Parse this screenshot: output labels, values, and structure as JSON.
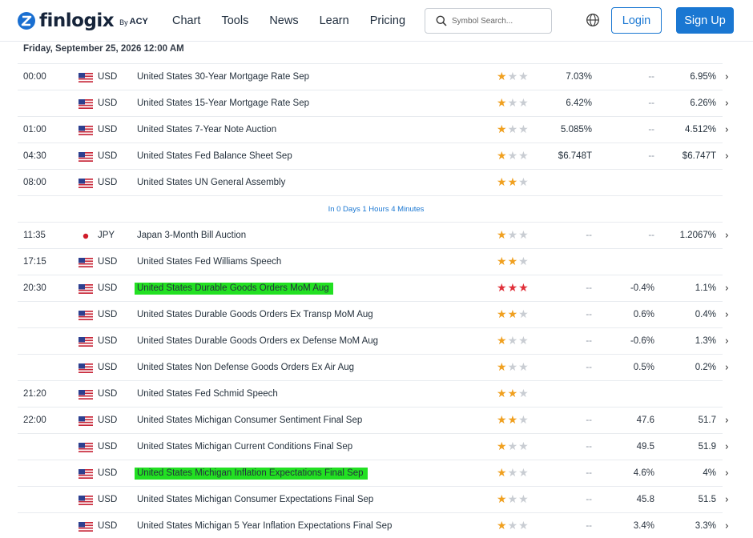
{
  "brand": {
    "name": "finlogix",
    "by": "By",
    "partner": "ACY"
  },
  "nav": [
    "Chart",
    "Tools",
    "News",
    "Learn",
    "Pricing"
  ],
  "search": {
    "placeholder": "Symbol Search..."
  },
  "auth": {
    "login": "Login",
    "signup": "Sign Up"
  },
  "colors": {
    "accent": "#1a77d2",
    "star_active": "#f0a020",
    "star_high": "#e0303a",
    "star_inactive": "#c9cdd3",
    "highlight": "#22e022"
  },
  "date_heading": "Friday, September 25, 2026 12:00 AM",
  "countdown": "In 0 Days 1 Hours 4 Minutes",
  "events": [
    {
      "time": "00:00",
      "flag": "US",
      "currency": "USD",
      "name": "United States 30-Year Mortgage Rate Sep",
      "importance": 1,
      "actual": "7.03%",
      "forecast": "--",
      "previous": "6.95%",
      "highlight": false
    },
    {
      "time": "",
      "flag": "US",
      "currency": "USD",
      "name": "United States 15-Year Mortgage Rate Sep",
      "importance": 1,
      "actual": "6.42%",
      "forecast": "--",
      "previous": "6.26%",
      "highlight": false
    },
    {
      "time": "01:00",
      "flag": "US",
      "currency": "USD",
      "name": "United States 7-Year Note Auction",
      "importance": 1,
      "actual": "5.085%",
      "forecast": "--",
      "previous": "4.512%",
      "highlight": false
    },
    {
      "time": "04:30",
      "flag": "US",
      "currency": "USD",
      "name": "United States Fed Balance Sheet Sep",
      "importance": 1,
      "actual": "$6.748T",
      "forecast": "--",
      "previous": "$6.747T",
      "highlight": false
    },
    {
      "time": "08:00",
      "flag": "US",
      "currency": "USD",
      "name": "United States UN General Assembly",
      "importance": 2,
      "actual": "",
      "forecast": "",
      "previous": "",
      "highlight": false
    },
    {
      "countdown": true
    },
    {
      "time": "11:35",
      "flag": "JP",
      "currency": "JPY",
      "name": "Japan 3-Month Bill Auction",
      "importance": 1,
      "actual": "--",
      "forecast": "--",
      "previous": "1.2067%",
      "highlight": false
    },
    {
      "time": "17:15",
      "flag": "US",
      "currency": "USD",
      "name": "United States Fed Williams Speech",
      "importance": 2,
      "actual": "",
      "forecast": "",
      "previous": "",
      "highlight": false
    },
    {
      "time": "20:30",
      "flag": "US",
      "currency": "USD",
      "name": "United States Durable Goods Orders MoM Aug",
      "importance": 3,
      "actual": "--",
      "forecast": "-0.4%",
      "previous": "1.1%",
      "highlight": true
    },
    {
      "time": "",
      "flag": "US",
      "currency": "USD",
      "name": "United States Durable Goods Orders Ex Transp MoM Aug",
      "importance": 2,
      "actual": "--",
      "forecast": "0.6%",
      "previous": "0.4%",
      "highlight": false
    },
    {
      "time": "",
      "flag": "US",
      "currency": "USD",
      "name": "United States Durable Goods Orders ex Defense MoM Aug",
      "importance": 1,
      "actual": "--",
      "forecast": "-0.6%",
      "previous": "1.3%",
      "highlight": false
    },
    {
      "time": "",
      "flag": "US",
      "currency": "USD",
      "name": "United States Non Defense Goods Orders Ex Air Aug",
      "importance": 1,
      "actual": "--",
      "forecast": "0.5%",
      "previous": "0.2%",
      "highlight": false
    },
    {
      "time": "21:20",
      "flag": "US",
      "currency": "USD",
      "name": "United States Fed Schmid Speech",
      "importance": 2,
      "actual": "",
      "forecast": "",
      "previous": "",
      "highlight": false
    },
    {
      "time": "22:00",
      "flag": "US",
      "currency": "USD",
      "name": "United States Michigan Consumer Sentiment Final Sep",
      "importance": 2,
      "actual": "--",
      "forecast": "47.6",
      "previous": "51.7",
      "highlight": false
    },
    {
      "time": "",
      "flag": "US",
      "currency": "USD",
      "name": "United States Michigan Current Conditions Final Sep",
      "importance": 1,
      "actual": "--",
      "forecast": "49.5",
      "previous": "51.9",
      "highlight": false
    },
    {
      "time": "",
      "flag": "US",
      "currency": "USD",
      "name": "United States Michigan Inflation Expectations Final Sep",
      "importance": 1,
      "actual": "--",
      "forecast": "4.6%",
      "previous": "4%",
      "highlight": true
    },
    {
      "time": "",
      "flag": "US",
      "currency": "USD",
      "name": "United States Michigan Consumer Expectations Final Sep",
      "importance": 1,
      "actual": "--",
      "forecast": "45.8",
      "previous": "51.5",
      "highlight": false
    },
    {
      "time": "",
      "flag": "US",
      "currency": "USD",
      "name": "United States Michigan 5 Year Inflation Expectations Final Sep",
      "importance": 1,
      "actual": "--",
      "forecast": "3.4%",
      "previous": "3.3%",
      "highlight": false
    }
  ]
}
